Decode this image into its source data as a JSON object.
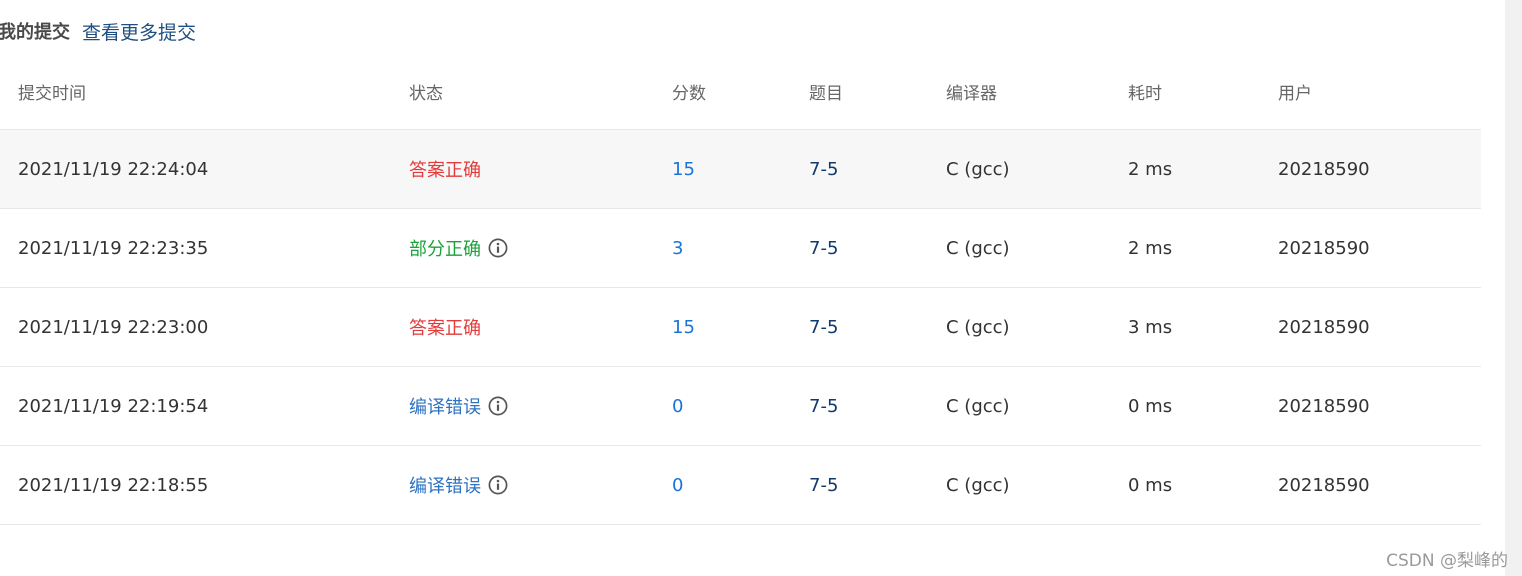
{
  "header": {
    "title": "我的提交",
    "more_link": "查看更多提交"
  },
  "columns": {
    "time": "提交时间",
    "status": "状态",
    "score": "分数",
    "problem": "题目",
    "compiler": "编译器",
    "duration": "耗时",
    "user": "用户"
  },
  "colors": {
    "accepted": "#e33b3b",
    "partial": "#1aa33a",
    "compile_error": "#2e72c2",
    "score_link": "#1a73d9",
    "problem_link": "#103a6b"
  },
  "rows": [
    {
      "time": "2021/11/19 22:24:04",
      "status": "答案正确",
      "status_kind": "accepted",
      "has_info": false,
      "score": "15",
      "problem": "7-5",
      "compiler": "C (gcc)",
      "duration": "2 ms",
      "user": "20218590"
    },
    {
      "time": "2021/11/19 22:23:35",
      "status": "部分正确",
      "status_kind": "partial",
      "has_info": true,
      "score": "3",
      "problem": "7-5",
      "compiler": "C (gcc)",
      "duration": "2 ms",
      "user": "20218590"
    },
    {
      "time": "2021/11/19 22:23:00",
      "status": "答案正确",
      "status_kind": "accepted",
      "has_info": false,
      "score": "15",
      "problem": "7-5",
      "compiler": "C (gcc)",
      "duration": "3 ms",
      "user": "20218590"
    },
    {
      "time": "2021/11/19 22:19:54",
      "status": "编译错误",
      "status_kind": "compile_error",
      "has_info": true,
      "score": "0",
      "problem": "7-5",
      "compiler": "C (gcc)",
      "duration": "0 ms",
      "user": "20218590"
    },
    {
      "time": "2021/11/19 22:18:55",
      "status": "编译错误",
      "status_kind": "compile_error",
      "has_info": true,
      "score": "0",
      "problem": "7-5",
      "compiler": "C (gcc)",
      "duration": "0 ms",
      "user": "20218590"
    }
  ],
  "watermark": "CSDN @梨峰的"
}
